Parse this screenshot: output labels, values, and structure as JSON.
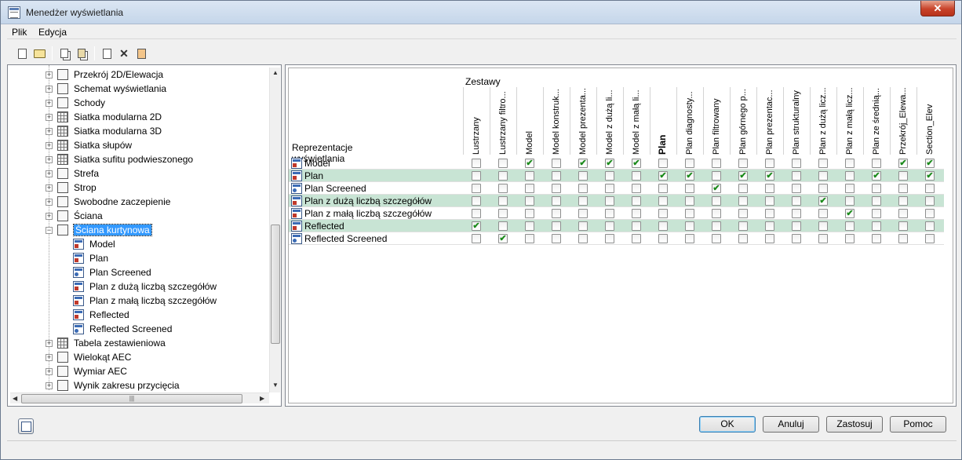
{
  "window": {
    "title": "Menedżer wyświetlania",
    "close_label": "✕"
  },
  "menubar": {
    "items": [
      "Plik",
      "Edycja"
    ]
  },
  "toolbar": {
    "icons": [
      "new-icon",
      "open-icon",
      "copy-icon",
      "paste-icon",
      "export-icon",
      "delete-icon",
      "purge-icon"
    ]
  },
  "tree": {
    "items": [
      {
        "label": "Przekrój 2D/Elewacja",
        "icon": "section-icon",
        "expanded": false
      },
      {
        "label": "Schemat wyświetlania",
        "icon": "schedule-icon",
        "expanded": false
      },
      {
        "label": "Schody",
        "icon": "stairs-icon",
        "expanded": false
      },
      {
        "label": "Siatka modularna 2D",
        "icon": "grid2d-icon",
        "expanded": false
      },
      {
        "label": "Siatka modularna 3D",
        "icon": "grid3d-icon",
        "expanded": false
      },
      {
        "label": "Siatka słupów",
        "icon": "column-grid-icon",
        "expanded": false
      },
      {
        "label": "Siatka sufitu podwieszonego",
        "icon": "ceiling-grid-icon",
        "expanded": false
      },
      {
        "label": "Strefa",
        "icon": "zone-icon",
        "expanded": false
      },
      {
        "label": "Strop",
        "icon": "slab-icon",
        "expanded": false
      },
      {
        "label": "Swobodne zaczepienie",
        "icon": "anchor-icon",
        "expanded": false
      },
      {
        "label": "Ściana",
        "icon": "wall-icon",
        "expanded": false
      },
      {
        "label": "Ściana kurtynowa",
        "icon": "curtain-wall-icon",
        "expanded": true,
        "selected": true
      }
    ],
    "children": [
      "Model",
      "Plan",
      "Plan Screened",
      "Plan z dużą liczbą szczegółów",
      "Plan z małą liczbą szczegółów",
      "Reflected",
      "Reflected Screened"
    ],
    "after": [
      {
        "label": "Tabela zestawieniowa",
        "icon": "table-icon"
      },
      {
        "label": "Wielokąt AEC",
        "icon": "polygon-icon"
      },
      {
        "label": "Wymiar AEC",
        "icon": "dimension-icon"
      },
      {
        "label": "Wynik zakresu przycięcia",
        "icon": "clip-icon"
      }
    ]
  },
  "grid": {
    "sets_header": "Zestawy",
    "rep_header": "Reprezentacje wyświetlania",
    "columns": [
      "Lustrzany",
      "Lustrzany filtro...",
      "Model",
      "Model konstruk...",
      "Model prezenta...",
      "Model z dużą li...",
      "Model z małą li...",
      "Plan",
      "Plan diagnosty...",
      "Plan filtrowany",
      "Plan górnego p...",
      "Plan prezentac...",
      "Plan strukturalny",
      "Plan z dużą licz...",
      "Plan z małą licz...",
      "Plan ze średnią...",
      "Przekrój_Elewa...",
      "Section_Elev"
    ],
    "bold_column": 7,
    "rows": [
      {
        "label": "Model",
        "checked": [
          2,
          4,
          5,
          6,
          16,
          17
        ]
      },
      {
        "label": "Plan",
        "checked": [
          7,
          8,
          10,
          11,
          15,
          17
        ]
      },
      {
        "label": "Plan Screened",
        "checked": [
          9
        ]
      },
      {
        "label": "Plan z dużą liczbą szczegółów",
        "checked": [
          13
        ]
      },
      {
        "label": "Plan z małą liczbą szczegółów",
        "checked": [
          14
        ]
      },
      {
        "label": "Reflected",
        "checked": [
          0
        ]
      },
      {
        "label": "Reflected Screened",
        "checked": [
          1
        ]
      }
    ],
    "selected_rows": [
      1,
      3,
      5
    ]
  },
  "buttons": {
    "ok": "OK",
    "cancel": "Anuluj",
    "apply": "Zastosuj",
    "help": "Pomoc"
  },
  "colors": {
    "selected_row": "#c8e4d4",
    "tree_selection": "#3399ff"
  }
}
